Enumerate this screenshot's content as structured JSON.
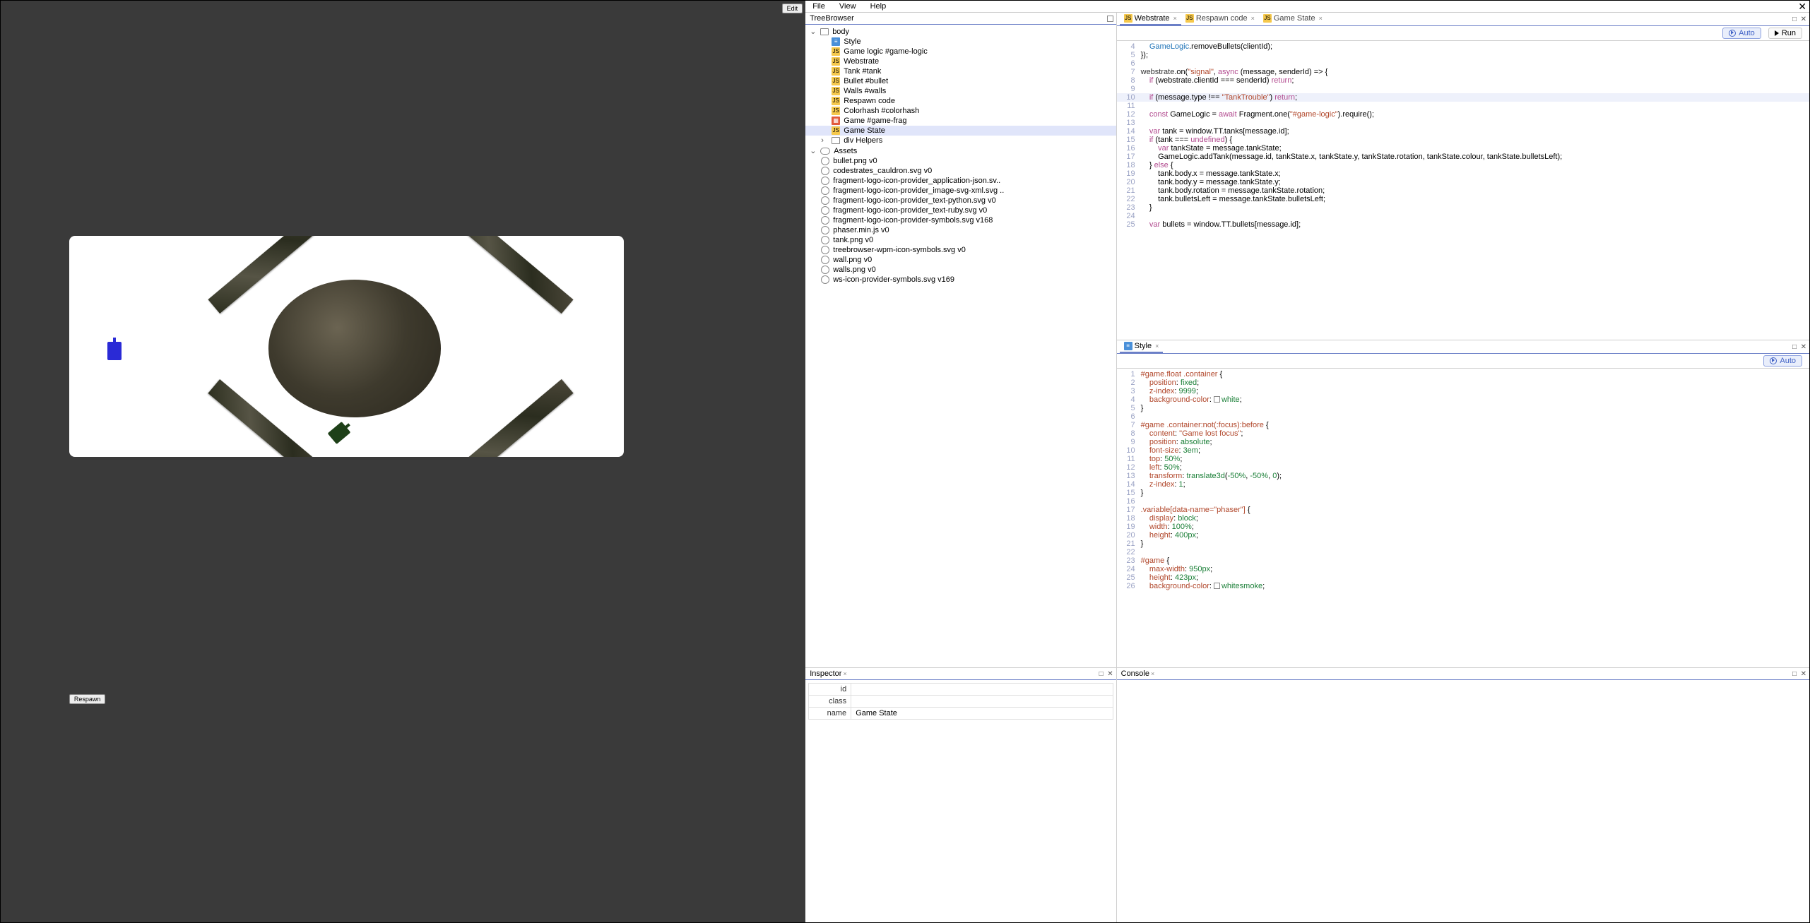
{
  "preview": {
    "edit_label": "Edit",
    "respawn_label": "Respawn"
  },
  "menubar": {
    "items": [
      "File",
      "View",
      "Help"
    ]
  },
  "tree": {
    "title": "TreeBrowser",
    "root": "body",
    "body_items": [
      {
        "icon": "css",
        "label": "Style"
      },
      {
        "icon": "js",
        "label": "Game logic #game-logic"
      },
      {
        "icon": "js",
        "label": "Webstrate"
      },
      {
        "icon": "js",
        "label": "Tank #tank"
      },
      {
        "icon": "js",
        "label": "Bullet #bullet"
      },
      {
        "icon": "js",
        "label": "Walls #walls"
      },
      {
        "icon": "js",
        "label": "Respawn code"
      },
      {
        "icon": "js",
        "label": "Colorhash #colorhash"
      },
      {
        "icon": "html",
        "label": "Game #game-frag"
      },
      {
        "icon": "js",
        "label": "Game State",
        "selected": true
      }
    ],
    "helpers_label": "div Helpers",
    "assets_label": "Assets",
    "assets": [
      "bullet.png v0",
      "codestrates_cauldron.svg v0",
      "fragment-logo-icon-provider_application-json.sv..",
      "fragment-logo-icon-provider_image-svg-xml.svg ..",
      "fragment-logo-icon-provider_text-python.svg v0",
      "fragment-logo-icon-provider_text-ruby.svg v0",
      "fragment-logo-icon-provider-symbols.svg v168",
      "phaser.min.js v0",
      "tank.png v0",
      "treebrowser-wpm-icon-symbols.svg v0",
      "wall.png v0",
      "walls.png v0",
      "ws-icon-provider-symbols.svg v169"
    ]
  },
  "inspector": {
    "title": "Inspector",
    "rows": [
      {
        "k": "id",
        "v": ""
      },
      {
        "k": "class",
        "v": ""
      },
      {
        "k": "name",
        "v": "Game State"
      }
    ]
  },
  "tabs_top": [
    {
      "icon": "js",
      "label": "Webstrate",
      "active": true
    },
    {
      "icon": "js",
      "label": "Respawn code",
      "active": false
    },
    {
      "icon": "js",
      "label": "Game State",
      "active": false
    }
  ],
  "toolbar": {
    "auto": "Auto",
    "run": "Run"
  },
  "code_top": {
    "start": 4,
    "highlight": 10,
    "lines": [
      [
        [
          "    "
        ],
        [
          "fn",
          "GameLogic"
        ],
        [
          ".removeBullets(clientId);"
        ]
      ],
      [
        [
          "});"
        ]
      ],
      [
        [
          ""
        ]
      ],
      [
        [
          "id",
          "webstrate"
        ],
        [
          ".on("
        ],
        [
          "str",
          "\"signal\""
        ],
        [
          ", "
        ],
        [
          "kw",
          "async"
        ],
        [
          " (message, senderId) => {"
        ]
      ],
      [
        [
          "    "
        ],
        [
          "kw",
          "if"
        ],
        [
          " (webstrate.clientId === senderId) "
        ],
        [
          "kw",
          "return"
        ],
        [
          ";"
        ]
      ],
      [
        [
          ""
        ]
      ],
      [
        [
          "    "
        ],
        [
          "kw",
          "if"
        ],
        [
          " (message.type !== "
        ],
        [
          "str",
          "\"TankTrouble\""
        ],
        [
          ") "
        ],
        [
          "kw",
          "return"
        ],
        [
          ";"
        ]
      ],
      [
        [
          ""
        ]
      ],
      [
        [
          "    "
        ],
        [
          "kw",
          "const"
        ],
        [
          " GameLogic = "
        ],
        [
          "kw",
          "await"
        ],
        [
          " Fragment.one("
        ],
        [
          "str",
          "\"#game-logic\""
        ],
        [
          ").require();"
        ]
      ],
      [
        [
          ""
        ]
      ],
      [
        [
          "    "
        ],
        [
          "kw",
          "var"
        ],
        [
          " tank = window.TT.tanks[message.id];"
        ]
      ],
      [
        [
          "    "
        ],
        [
          "kw",
          "if"
        ],
        [
          " (tank === "
        ],
        [
          "kw",
          "undefined"
        ],
        [
          ") {"
        ]
      ],
      [
        [
          "        "
        ],
        [
          "kw",
          "var"
        ],
        [
          " tankState = message.tankState;"
        ]
      ],
      [
        [
          "        GameLogic.addTank(message.id, tankState.x, tankState.y, tankState.rotation, tankState.colour, tankState.bulletsLeft);"
        ]
      ],
      [
        [
          "    } "
        ],
        [
          "kw",
          "else"
        ],
        [
          " {"
        ]
      ],
      [
        [
          "        tank.body.x = message.tankState.x;"
        ]
      ],
      [
        [
          "        tank.body.y = message.tankState.y;"
        ]
      ],
      [
        [
          "        tank.body.rotation = message.tankState.rotation;"
        ]
      ],
      [
        [
          "        tank.bulletsLeft = message.tankState.bulletsLeft;"
        ]
      ],
      [
        [
          "    }"
        ]
      ],
      [
        [
          ""
        ]
      ],
      [
        [
          "    "
        ],
        [
          "kw",
          "var"
        ],
        [
          " bullets = window.TT.bullets[message.id];"
        ]
      ]
    ]
  },
  "tabs_mid": [
    {
      "icon": "css",
      "label": "Style",
      "active": true
    }
  ],
  "code_mid": {
    "start": 1,
    "lines": [
      [
        [
          "sel",
          "#game.float .container"
        ],
        [
          " {"
        ]
      ],
      [
        [
          "    "
        ],
        [
          "prop",
          "position"
        ],
        [
          ": "
        ],
        [
          "val",
          "fixed"
        ],
        [
          ";"
        ]
      ],
      [
        [
          "    "
        ],
        [
          "prop",
          "z-index"
        ],
        [
          ": "
        ],
        [
          "num",
          "9999"
        ],
        [
          ";"
        ]
      ],
      [
        [
          "    "
        ],
        [
          "prop",
          "background-color"
        ],
        [
          ": "
        ],
        [
          "chip",
          ""
        ],
        [
          "val",
          "white"
        ],
        [
          ";"
        ]
      ],
      [
        [
          "}"
        ]
      ],
      [
        [
          ""
        ]
      ],
      [
        [
          "sel",
          "#game .container:not(:focus):before"
        ],
        [
          " {"
        ]
      ],
      [
        [
          "    "
        ],
        [
          "prop",
          "content"
        ],
        [
          ": "
        ],
        [
          "str",
          "\"Game lost focus\""
        ],
        [
          ";"
        ]
      ],
      [
        [
          "    "
        ],
        [
          "prop",
          "position"
        ],
        [
          ": "
        ],
        [
          "val",
          "absolute"
        ],
        [
          ";"
        ]
      ],
      [
        [
          "    "
        ],
        [
          "prop",
          "font-size"
        ],
        [
          ": "
        ],
        [
          "num",
          "3em"
        ],
        [
          ";"
        ]
      ],
      [
        [
          "    "
        ],
        [
          "prop",
          "top"
        ],
        [
          ": "
        ],
        [
          "num",
          "50%"
        ],
        [
          ";"
        ]
      ],
      [
        [
          "    "
        ],
        [
          "prop",
          "left"
        ],
        [
          ": "
        ],
        [
          "num",
          "50%"
        ],
        [
          ";"
        ]
      ],
      [
        [
          "    "
        ],
        [
          "prop",
          "transform"
        ],
        [
          ": "
        ],
        [
          "val",
          "translate3d"
        ],
        [
          "("
        ],
        [
          "num",
          "-50%"
        ],
        [
          ", "
        ],
        [
          "num",
          "-50%"
        ],
        [
          ", "
        ],
        [
          "num",
          "0"
        ],
        [
          ");"
        ]
      ],
      [
        [
          "    "
        ],
        [
          "prop",
          "z-index"
        ],
        [
          ": "
        ],
        [
          "num",
          "1"
        ],
        [
          ";"
        ]
      ],
      [
        [
          "}"
        ]
      ],
      [
        [
          ""
        ]
      ],
      [
        [
          "sel",
          ".variable[data-name=\"phaser\"]"
        ],
        [
          " {"
        ]
      ],
      [
        [
          "    "
        ],
        [
          "prop",
          "display"
        ],
        [
          ": "
        ],
        [
          "val",
          "block"
        ],
        [
          ";"
        ]
      ],
      [
        [
          "    "
        ],
        [
          "prop",
          "width"
        ],
        [
          ": "
        ],
        [
          "num",
          "100%"
        ],
        [
          ";"
        ]
      ],
      [
        [
          "    "
        ],
        [
          "prop",
          "height"
        ],
        [
          ": "
        ],
        [
          "num",
          "400px"
        ],
        [
          ";"
        ]
      ],
      [
        [
          "}"
        ]
      ],
      [
        [
          ""
        ]
      ],
      [
        [
          "sel",
          "#game"
        ],
        [
          " {"
        ]
      ],
      [
        [
          "    "
        ],
        [
          "prop",
          "max-width"
        ],
        [
          ": "
        ],
        [
          "num",
          "950px"
        ],
        [
          ";"
        ]
      ],
      [
        [
          "    "
        ],
        [
          "prop",
          "height"
        ],
        [
          ": "
        ],
        [
          "num",
          "423px"
        ],
        [
          ";"
        ]
      ],
      [
        [
          "    "
        ],
        [
          "prop",
          "background-color"
        ],
        [
          ": "
        ],
        [
          "chip",
          ""
        ],
        [
          "val",
          "whitesmoke"
        ],
        [
          ";"
        ]
      ]
    ]
  },
  "console": {
    "title": "Console"
  }
}
